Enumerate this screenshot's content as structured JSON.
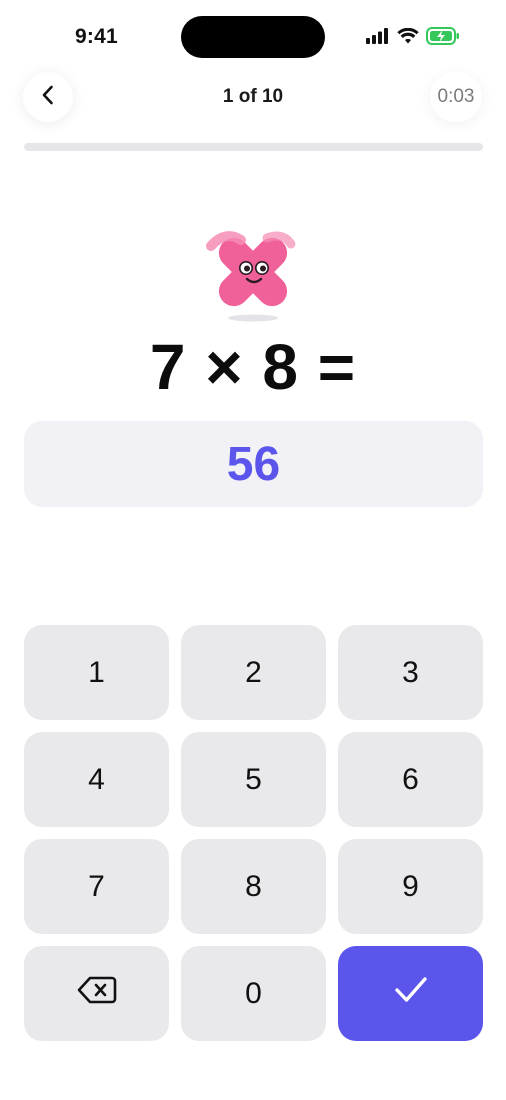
{
  "status_bar": {
    "time": "9:41",
    "icons": [
      "cellular-signal-icon",
      "wifi-icon",
      "battery-charging-icon"
    ],
    "battery_color": "#34c759"
  },
  "header": {
    "back_icon": "chevron-left-icon",
    "title": "1 of 10",
    "timer": "0:03"
  },
  "progress": {
    "current": 1,
    "total": 10,
    "fraction": 0,
    "fill_color": "#5b55ec",
    "track_color": "#e6e6ea"
  },
  "mascot": {
    "icon": "multiply-mascot-icon",
    "color": "#f0619a"
  },
  "question": {
    "text": "7 × 8 ="
  },
  "answer": {
    "value": "56",
    "color": "#5b55ec"
  },
  "keypad": {
    "keys": [
      "1",
      "2",
      "3",
      "4",
      "5",
      "6",
      "7",
      "8",
      "9"
    ],
    "zero": "0",
    "backspace_icon": "backspace-icon",
    "submit_icon": "checkmark-icon",
    "submit_color": "#5b55ec"
  }
}
